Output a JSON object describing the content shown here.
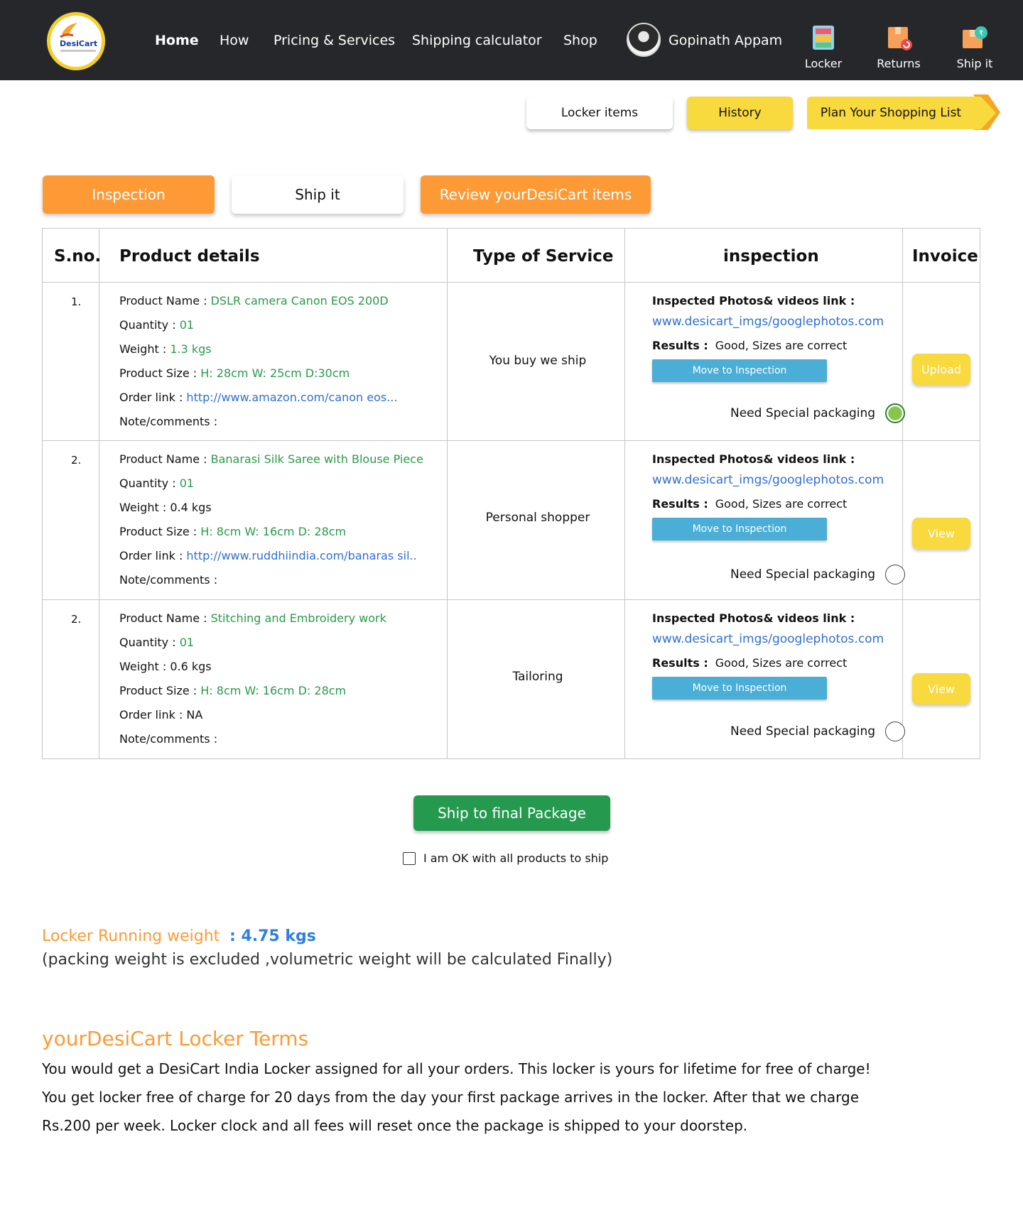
{
  "header": {
    "logo_text": "DesiCart",
    "nav": [
      "Home",
      "How",
      "Pricing & Services",
      "Shipping calculator",
      "Shop"
    ],
    "user_name": "Gopinath Appam",
    "tools": [
      {
        "label": "Locker",
        "icon": "locker-icon"
      },
      {
        "label": "Returns",
        "icon": "returns-icon"
      },
      {
        "label": "Ship it",
        "icon": "ship-it-icon"
      }
    ]
  },
  "top_buttons": {
    "locker_items": "Locker items",
    "history": "History",
    "plan": "Plan Your Shopping List"
  },
  "tabs": {
    "inspection": "Inspection",
    "ship_it": "Ship it",
    "review": "Review yourDesiCart items"
  },
  "table": {
    "headers": [
      "S.no.",
      "Product details",
      "Type of Service",
      "inspection",
      "Invoice"
    ],
    "field_labels": {
      "name": "Product Name : ",
      "quantity": "Quantity : ",
      "weight": "Weight : ",
      "size": "Product Size : ",
      "link": "Order link : ",
      "notes": "Note/comments :",
      "photos": "Inspected Photos& videos link :",
      "results": "Results  :",
      "move": "Move to Inspection",
      "packaging": "Need Special packaging"
    },
    "rows": [
      {
        "sno": "1.",
        "name": "DSLR camera Canon EOS 200D",
        "quantity": "01",
        "weight": "1.3 kgs",
        "size": "H: 28cm W: 25cm  D:30cm",
        "link": "http://www.amazon.com/canon eos...",
        "service": "You buy we ship",
        "photo_link": "www.desicart_imgs/googlephotos.com",
        "results": "Good, Sizes are correct",
        "special_packaging": true,
        "invoice": "Upload"
      },
      {
        "sno": "2.",
        "name": "Banarasi Silk Saree with Blouse Piece",
        "quantity": "01",
        "weight": "0.4 kgs",
        "size": "H: 8cm W: 16cm  D: 28cm",
        "link": "http://www.ruddhiindia.com/banaras sil..",
        "service": "Personal shopper",
        "photo_link": "www.desicart_imgs/googlephotos.com",
        "results": "Good, Sizes are correct",
        "special_packaging": false,
        "invoice": "View"
      },
      {
        "sno": "2.",
        "name": "Stitching and Embroidery work",
        "quantity": "01",
        "weight": "0.6 kgs",
        "size": "H: 8cm W: 16cm  D: 28cm",
        "link": "NA",
        "service": "Tailoring",
        "photo_link": "www.desicart_imgs/googlephotos.com",
        "results": "Good, Sizes are correct",
        "special_packaging": false,
        "invoice": "View"
      }
    ]
  },
  "ship_final": "Ship to final Package",
  "ok_label": "I am OK with all products to ship",
  "locker_weight": {
    "label": "Locker Running weight",
    "value": ": 4.75 kgs",
    "note": "(packing weight is excluded ,volumetric weight will be calculated Finally)"
  },
  "terms": {
    "title": "yourDesiCart Locker Terms",
    "lines": [
      "You would get a DesiCart India Locker assigned for all your orders. This locker is yours for lifetime for free of charge!",
      "You get locker free of charge for 20 days from the day your first package arrives in the locker. After that we charge",
      "Rs.200 per week. Locker clock and all fees will reset once the package is shipped to your doorstep."
    ]
  },
  "colors": {
    "header_bg": "#26272b",
    "orange": "#fd9a36",
    "yellow": "#f8d93e",
    "green_btn": "#259a4f",
    "link_blue": "#2f6fd6",
    "value_green": "#2a9a4a",
    "move_btn": "#4aaed6"
  }
}
